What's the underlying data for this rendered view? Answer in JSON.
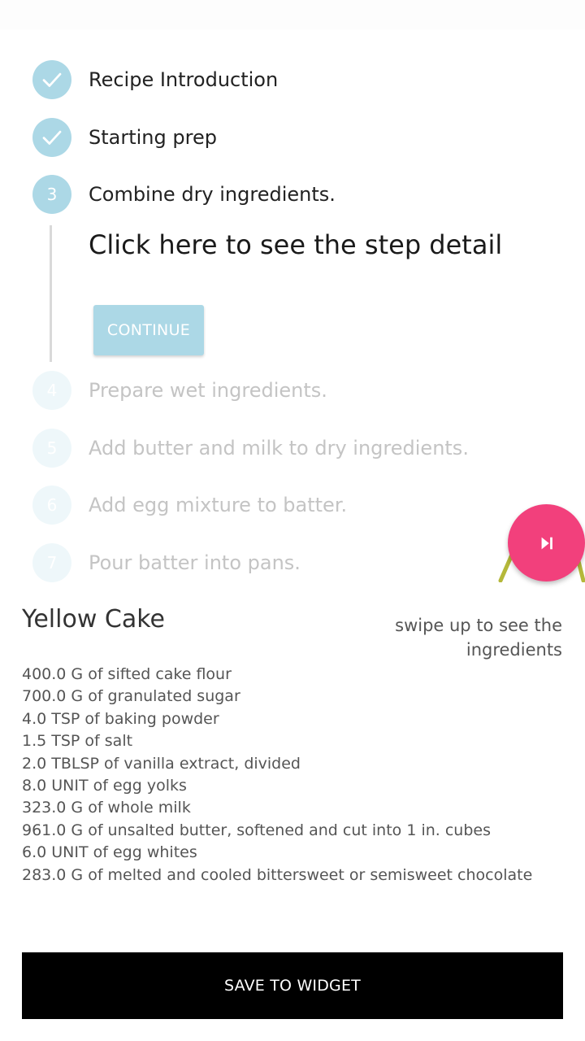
{
  "steps": [
    {
      "number": "1",
      "label": "Recipe Introduction",
      "state": "completed"
    },
    {
      "number": "2",
      "label": "Starting prep",
      "state": "completed"
    },
    {
      "number": "3",
      "label": "Combine dry ingredients.",
      "state": "active"
    },
    {
      "number": "4",
      "label": "Prepare wet ingredients.",
      "state": "inactive"
    },
    {
      "number": "5",
      "label": "Add butter and milk to dry ingredients.",
      "state": "inactive"
    },
    {
      "number": "6",
      "label": "Add egg mixture to batter.",
      "state": "inactive"
    },
    {
      "number": "7",
      "label": "Pour batter into pans.",
      "state": "inactive"
    }
  ],
  "active_step": {
    "detail_prompt": "Click here to see the step detail",
    "continue_label": "CONTINUE"
  },
  "fab": {
    "icon": "skip-next-icon",
    "color": "#f2407c"
  },
  "recipe": {
    "title": "Yellow Cake",
    "swipe_hint": "swipe up to see the ingredients",
    "ingredients": [
      "400.0 G of sifted cake flour",
      "700.0 G of granulated sugar",
      "4.0 TSP of baking powder",
      "1.5 TSP of salt",
      "2.0 TBLSP of vanilla extract, divided",
      "8.0 UNIT of egg yolks",
      "323.0 G of whole milk",
      "961.0 G of unsalted butter, softened and cut into 1 in. cubes",
      "6.0 UNIT of egg whites",
      "283.0 G of melted and cooled bittersweet or semisweet chocolate"
    ]
  },
  "save_button_label": "SAVE TO WIDGET",
  "colors": {
    "step_accent": "#acd8e6",
    "step_inactive": "#eef7fa",
    "save_button": "#000000"
  }
}
